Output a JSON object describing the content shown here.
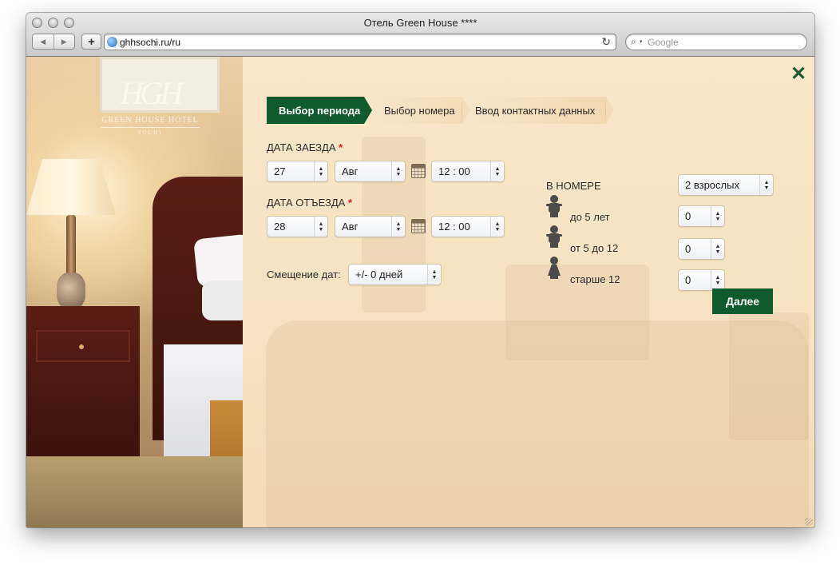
{
  "browser": {
    "window_title": "Отель Green House ****",
    "url": "ghhsochi.ru/ru",
    "search_placeholder": "Google",
    "back_glyph": "◀",
    "forward_glyph": "▶",
    "add_glyph": "+",
    "reload_glyph": "↻",
    "search_glyph": "⌕",
    "search_caret": "▾"
  },
  "brand": {
    "monogram": "HGH",
    "name": "GREEN HOUSE HOTEL",
    "city": "SOCHI"
  },
  "close_glyph": "✕",
  "steps": [
    {
      "label": "Выбор периода",
      "active": true
    },
    {
      "label": "Выбор номера",
      "active": false
    },
    {
      "label": "Ввод контактных данных",
      "active": false
    }
  ],
  "checkin": {
    "label": "ДАТА ЗАЕЗДА",
    "required_mark": "*",
    "day": "27",
    "month": "Авг",
    "time": "12 : 00"
  },
  "checkout": {
    "label": "ДАТА ОТЪЕЗДА",
    "required_mark": "*",
    "day": "28",
    "month": "Авг",
    "time": "12 : 00"
  },
  "date_shift": {
    "label": "Смещение дат:",
    "value": "+/- 0 дней"
  },
  "room": {
    "label": "В НОМЕРЕ",
    "adults": "2 взрослых",
    "guests": [
      {
        "label": "до 5 лет",
        "count": "0",
        "icon": "baby-icon"
      },
      {
        "label": "от 5 до 12",
        "count": "0",
        "icon": "child-icon"
      },
      {
        "label": "старше 12",
        "count": "0",
        "icon": "teen-icon"
      }
    ]
  },
  "next_button": "Далее",
  "colors": {
    "accent_green": "#0f5a2e",
    "panel_cream": "#f6e3c2",
    "required_red": "#d01f1f"
  }
}
